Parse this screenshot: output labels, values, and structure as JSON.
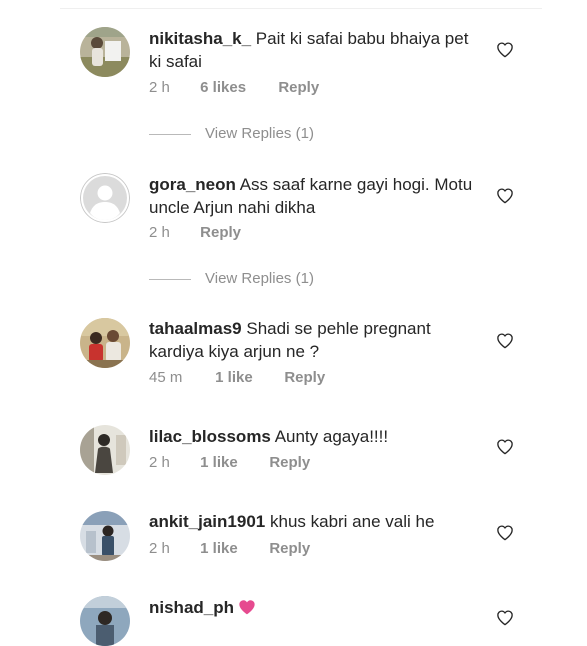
{
  "comments": [
    {
      "username": "nikitasha_k_",
      "text": "Pait ki safai babu bhaiya pet ki safai",
      "time": "2 h",
      "likes": "6 likes",
      "reply": "Reply",
      "view_replies": "View Replies (1)"
    },
    {
      "username": "gora_neon",
      "text": "Ass saaf karne gayi hogi. Motu uncle Arjun nahi dikha",
      "time": "2 h",
      "likes": "",
      "reply": "Reply",
      "view_replies": "View Replies (1)"
    },
    {
      "username": "tahaalmas9",
      "text": "Shadi se pehle pregnant kardiya kiya arjun ne ?",
      "time": "45 m",
      "likes": "1 like",
      "reply": "Reply",
      "view_replies": ""
    },
    {
      "username": "lilac_blossoms",
      "text": "Aunty agaya!!!!",
      "time": "2 h",
      "likes": "1 like",
      "reply": "Reply",
      "view_replies": ""
    },
    {
      "username": "ankit_jain1901",
      "text": "khus kabri ane vali he",
      "time": "2 h",
      "likes": "1 like",
      "reply": "Reply",
      "view_replies": ""
    },
    {
      "username": "nishad_ph",
      "text": "",
      "time": "",
      "likes": "",
      "reply": "",
      "view_replies": ""
    }
  ],
  "icons": {
    "like": "heart-outline-icon",
    "emoji": "pink-heart-emoji"
  },
  "colors": {
    "text": "#262626",
    "meta": "#8e8e8e",
    "emoji_heart": "#e64a8f"
  }
}
